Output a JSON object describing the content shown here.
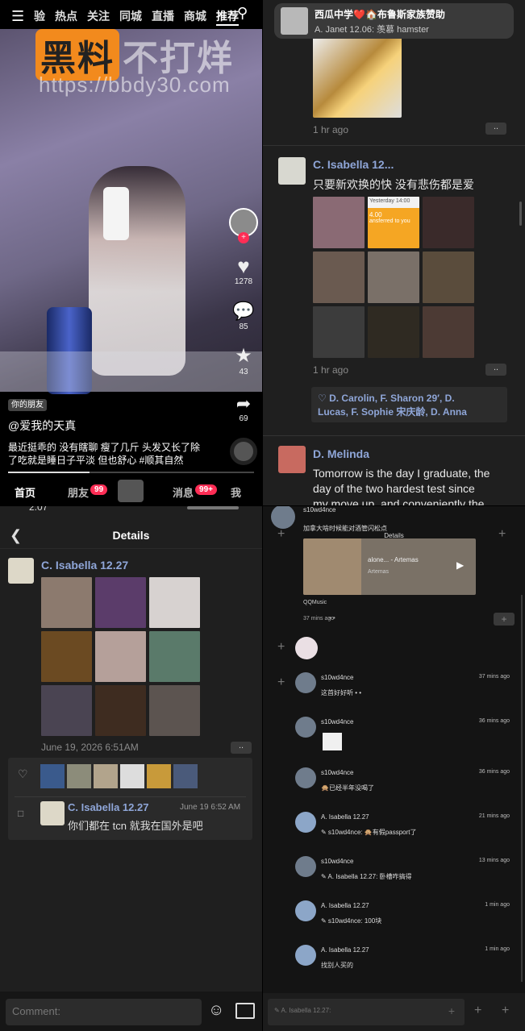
{
  "video_app": {
    "nav_items": [
      "验",
      "热点",
      "关注",
      "同城",
      "直播",
      "商城",
      "推荐"
    ],
    "active_nav": "推荐",
    "watermark_brand": "黑料",
    "watermark_text": "不打烊",
    "watermark_url": "https://bbdy30.com",
    "likes": "1278",
    "comments": "85",
    "favorites": "43",
    "shares": "69",
    "tag": "你的朋友",
    "author": "@爱我的天真",
    "caption_line1": "最近挺乖的 没有瞎聊 瘦了几斤 头发又长了除",
    "caption_line2": "了吃就是睡日子平淡 但也舒心 #顺其自然",
    "bottom_nav": {
      "home": "首页",
      "friends": "朋友",
      "friends_badge": "99",
      "messages": "消息",
      "messages_badge": "99+",
      "me": "我"
    }
  },
  "moments_feed": {
    "notification_title": "西瓜中学❤️🏠布鲁斯家族赞助",
    "notification_sub": "A. Janet 12.06: 羡慕 hamster",
    "post1_time": "1 hr ago",
    "post2_name": "C. Isabella 12...",
    "post2_text": "只要新欢换的快 没有悲伤都是爱",
    "post2_thumb_text": "Yesterday 14:00",
    "post2_thumb_text2": "4.00",
    "post2_thumb_text3": "ansferred to you",
    "post2_time": "1 hr ago",
    "likes_line1": "♡ D. Carolin, F. Sharon 29′, D.",
    "likes_line2": "Lucas, F. Sophie 宋庆龄, D. Anna",
    "post3_name": "D. Melinda",
    "post3_text_line1": "Tomorrow is the day I graduate, the",
    "post3_text_line2": "day of the two hardest test since",
    "post3_text_line3": "my move up, and conveniently the"
  },
  "details_light": {
    "status_time": "2:07",
    "title": "Details",
    "name": "C. Isabella 12.27",
    "date": "June 19, 2026 6:51AM",
    "comment_name": "C. Isabella 12.27",
    "comment_time": "June 19 6:52 AM",
    "comment_text": "你们都在 tcn 就我在国外是吧",
    "comment_placeholder": "Comment:"
  },
  "details_dark": {
    "title": "Details",
    "top_user": "s10wd4nce",
    "top_text": "加拿大啥时候能对酒管闪松点",
    "music_title": "alone... - Artemas",
    "music_artist": "Artemas",
    "music_source": "QQMusic",
    "music_time": "37 mins ago",
    "comments": [
      {
        "name": "s10wd4nce",
        "time": "37 mins ago",
        "text": "这首好好听 • •"
      },
      {
        "name": "s10wd4nce",
        "time": "36 mins ago",
        "text": ""
      },
      {
        "name": "s10wd4nce",
        "time": "36 mins ago",
        "text": "🙊已经半年没喝了"
      },
      {
        "name": "A. Isabella 12.27",
        "time": "21 mins ago",
        "text": "✎ s10wd4nce: 🙊有假passport了"
      },
      {
        "name": "s10wd4nce",
        "time": "13 mins ago",
        "text": "✎ A. Isabella 12.27: 卧槽咋搞得"
      },
      {
        "name": "A. Isabella 12.27",
        "time": "1 min ago",
        "text": "✎ s10wd4nce: 100块"
      },
      {
        "name": "A. Isabella 12.27",
        "time": "1 min ago",
        "text": "找别人买的"
      }
    ],
    "reply_placeholder": "✎ A. Isabella 12.27:"
  }
}
